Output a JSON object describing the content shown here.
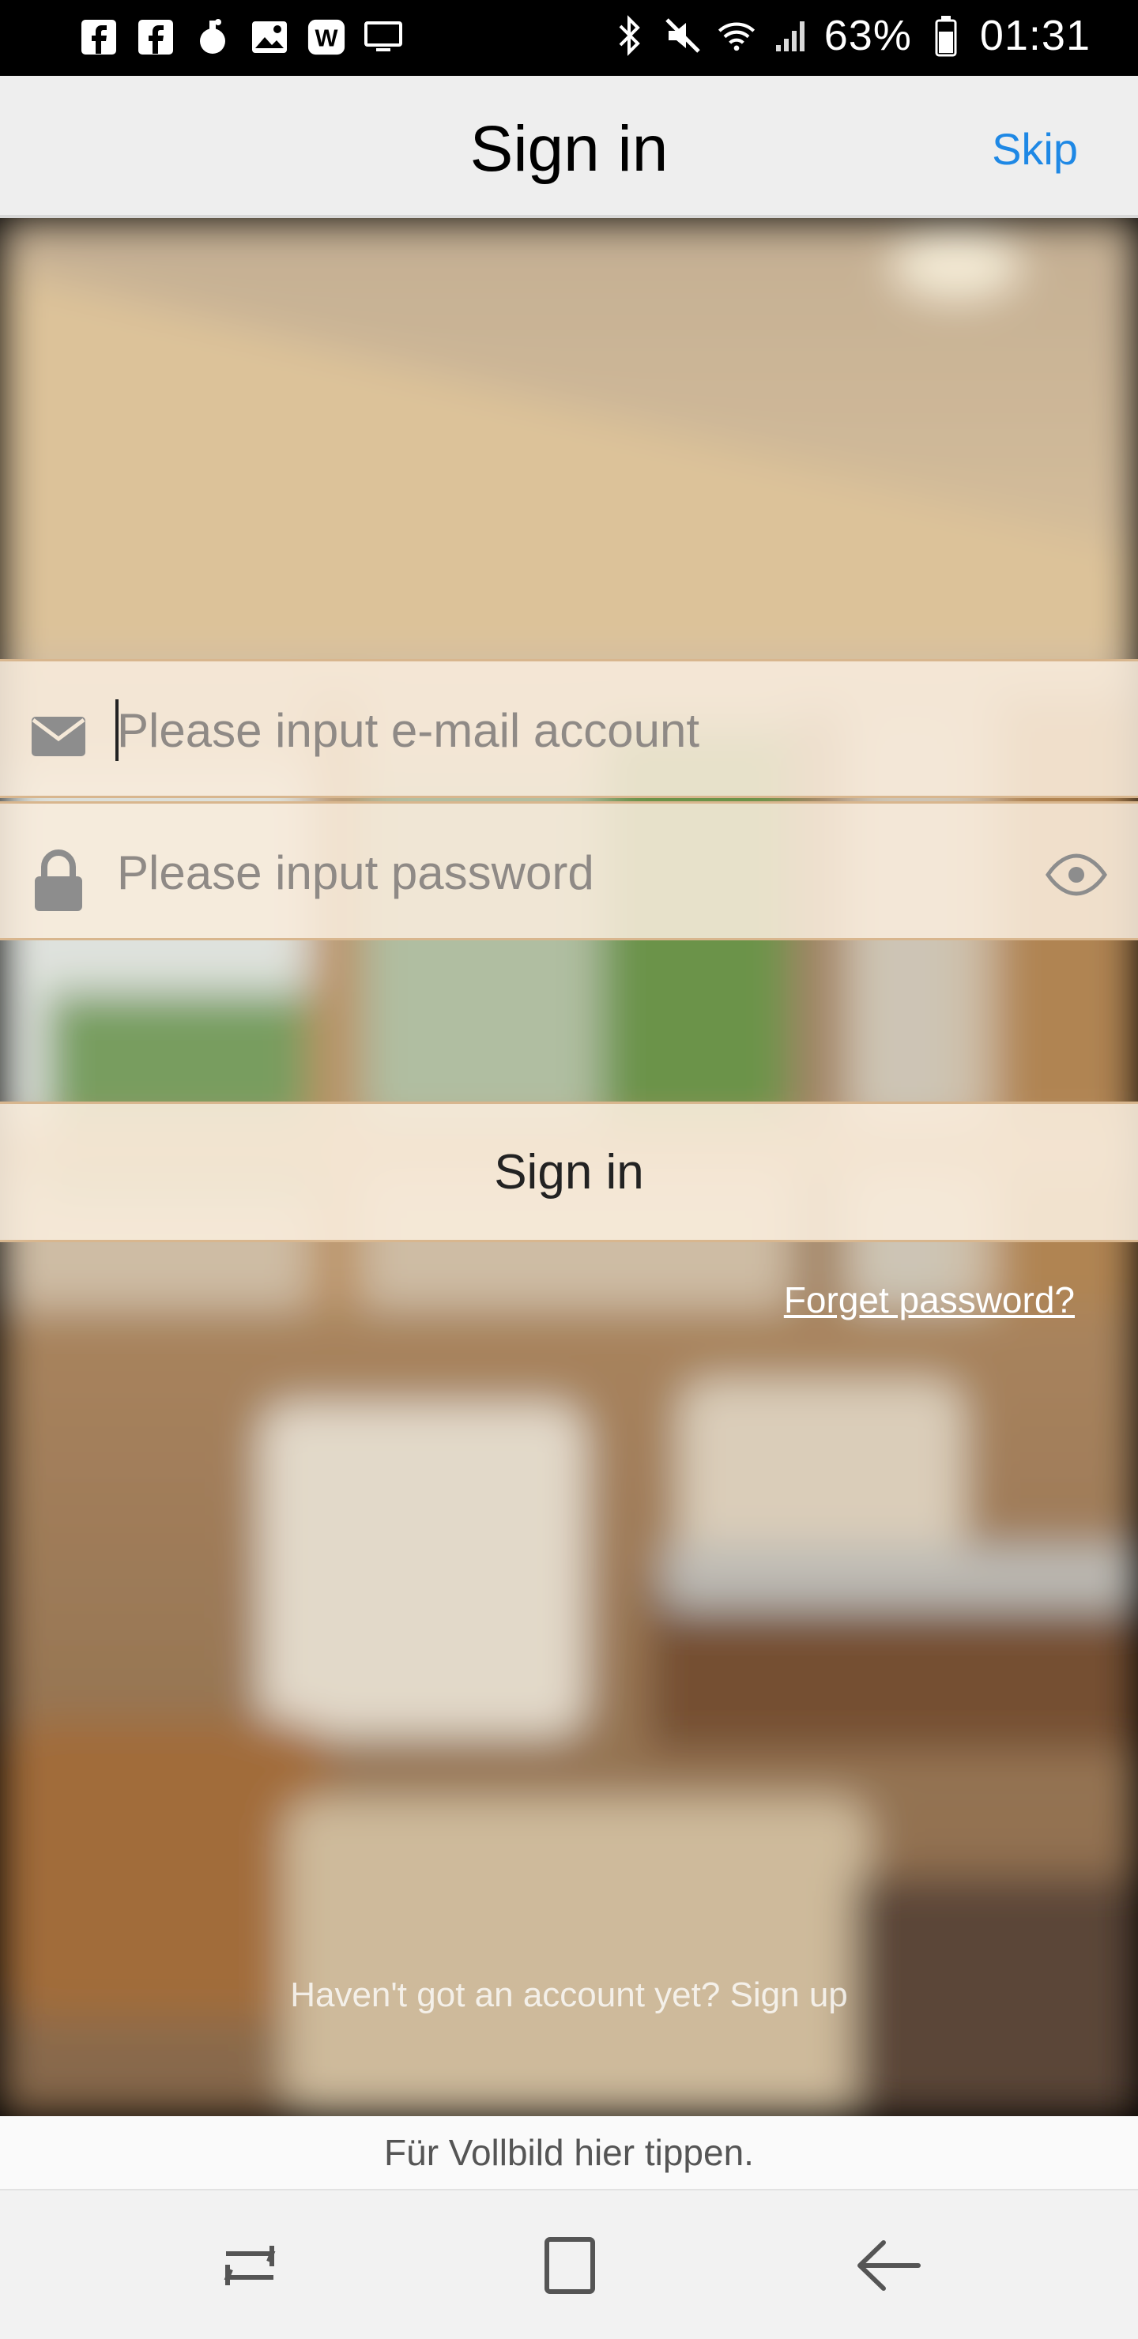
{
  "status_bar": {
    "left_icons": [
      "facebook-icon",
      "facebook-icon",
      "notification-bomb-icon",
      "gallery-icon",
      "word-icon",
      "screen-cast-icon"
    ],
    "right_icons": [
      "bluetooth-icon",
      "mute-icon",
      "wifi-icon",
      "signal-icon",
      "battery-icon"
    ],
    "battery": "63%",
    "time": "01:31"
  },
  "app_bar": {
    "title": "Sign in",
    "skip_label": "Skip",
    "skip_color": "#1e88e5"
  },
  "form": {
    "email": {
      "placeholder": "Please input e-mail account",
      "value": "",
      "icon": "envelope-icon"
    },
    "password": {
      "placeholder": "Please input password",
      "value": "",
      "icon": "lock-icon",
      "toggle_icon": "eye-icon"
    },
    "submit_label": "Sign in",
    "forget_label": "Forget password?"
  },
  "signup_text": "Haven't got an account yet? Sign up",
  "fullscreen_hint": "Für Vollbild hier tippen.",
  "nav_bar": {
    "items": [
      "recent-apps-icon",
      "home-icon",
      "back-icon"
    ]
  },
  "colors": {
    "field_background": "#f8ecdc",
    "field_border": "#d8b68e",
    "link": "#ffffff"
  }
}
